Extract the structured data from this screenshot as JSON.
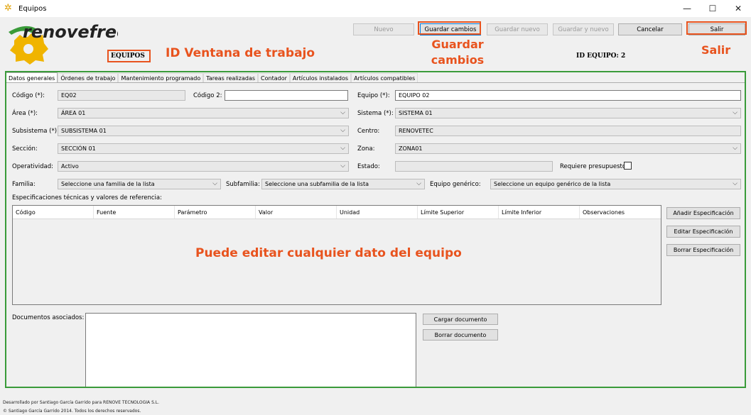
{
  "window": {
    "title": "Equipos",
    "minimize": "—",
    "maximize": "☐",
    "close": "✕"
  },
  "logo": {
    "text": "renovefree"
  },
  "toolbar": {
    "nuevo": "Nuevo",
    "guardar_cambios": "Guardar cambios",
    "guardar_nuevo": "Guardar nuevo",
    "guardar_y_nuevo": "Guardar y nuevo",
    "cancelar": "Cancelar",
    "salir": "Salir"
  },
  "header": {
    "equipos": "EQUIPOS",
    "id_equipo": "ID EQUIPO:  2"
  },
  "annotations": {
    "id_ventana": "ID Ventana de trabajo",
    "guardar_cambios": "Guardar cambios",
    "salir": "Salir",
    "editar": "Puede editar cualquier dato del equipo"
  },
  "tabs": [
    "Datos generales",
    "Órdenes de trabajo",
    "Mantenimiento programado",
    "Tareas realizadas",
    "Contador",
    "Artículos instalados",
    "Artículos compatibles"
  ],
  "form": {
    "codigo_label": "Código (*):",
    "codigo": "EQ02",
    "codigo2_label": "Código 2:",
    "codigo2": "",
    "equipo_label": "Equipo (*):",
    "equipo": "EQUIPO 02",
    "area_label": "Área (*):",
    "area": "ÁREA 01",
    "sistema_label": "Sistema (*):",
    "sistema": "SISTEMA 01",
    "subsistema_label": "Subsistema (*):",
    "subsistema": "SUBSISTEMA 01",
    "centro_label": "Centro:",
    "centro": "RENOVETEC",
    "seccion_label": "Sección:",
    "seccion": "SECCIÓN 01",
    "zona_label": "Zona:",
    "zona": "ZONA01",
    "operatividad_label": "Operatividad:",
    "operatividad": "Activo",
    "estado_label": "Estado:",
    "estado": "",
    "presupuesto_label": "Requiere presupuesto:",
    "familia_label": "Familia:",
    "familia": "Seleccione una familia de la lista",
    "subfamilia_label": "Subfamilia:",
    "subfamilia": "Seleccione una subfamilia de la lista",
    "generico_label": "Equipo genérico:",
    "generico": "Seleccione un equipo genérico de la lista",
    "specs_label": "Especificaciones técnicas y valores de referencia:",
    "docs_label": "Documentos asociados:"
  },
  "specs_columns": [
    "Código",
    "Fuente",
    "Parámetro",
    "Valor",
    "Unidad",
    "Límite Superior",
    "Límite Inferior",
    "Observaciones"
  ],
  "spec_buttons": {
    "add": "Añadir Especificación",
    "edit": "Editar Especificación",
    "delete": "Borrar Especificación"
  },
  "doc_buttons": {
    "load": "Cargar documento",
    "delete": "Borrar documento"
  },
  "footer": {
    "line1": "Desarrollado por Santiago García Garrido para RENOVE TECNOLOGIA S.L.",
    "line2": "© Santiago García Garrido 2014. Todos los derechos reservados."
  },
  "colors": {
    "annotation": "#e8531e",
    "frame": "#3a9b3a",
    "logo": "#f0b400"
  }
}
